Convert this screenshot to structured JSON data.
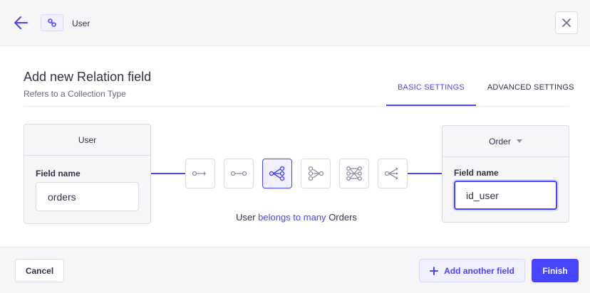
{
  "header": {
    "back_icon": "arrow-left-icon",
    "breadcrumb_icon": "link-icon",
    "breadcrumb_label": "User",
    "close_icon": "close-icon"
  },
  "form": {
    "title": "Add new Relation field",
    "subtitle": "Refers to a Collection Type",
    "tabs": [
      {
        "label": "BASIC SETTINGS",
        "active": true
      },
      {
        "label": "ADVANCED SETTINGS",
        "active": false
      }
    ]
  },
  "left_box": {
    "title": "User",
    "field_label": "Field name",
    "field_value": "orders"
  },
  "right_box": {
    "title": "Order",
    "dropdown_icon": "caret-down-icon",
    "field_label": "Field name",
    "field_value": "id_user"
  },
  "relations": [
    {
      "icon": "one-way-icon",
      "active": false
    },
    {
      "icon": "one-to-one-icon",
      "active": false
    },
    {
      "icon": "one-to-many-icon",
      "active": true
    },
    {
      "icon": "many-to-one-icon",
      "active": false
    },
    {
      "icon": "many-to-many-icon",
      "active": false
    },
    {
      "icon": "many-way-icon",
      "active": false
    }
  ],
  "relation_description": {
    "subject": "User",
    "relation": "belongs to many",
    "object": "Orders"
  },
  "footer": {
    "cancel_label": "Cancel",
    "add_label": "Add another field",
    "add_icon": "plus-icon",
    "finish_label": "Finish"
  },
  "colors": {
    "primary": "#4945ff",
    "primary_light": "#f0f0ff",
    "text": "#32324d",
    "muted": "#666687",
    "border": "#dcdce4"
  }
}
